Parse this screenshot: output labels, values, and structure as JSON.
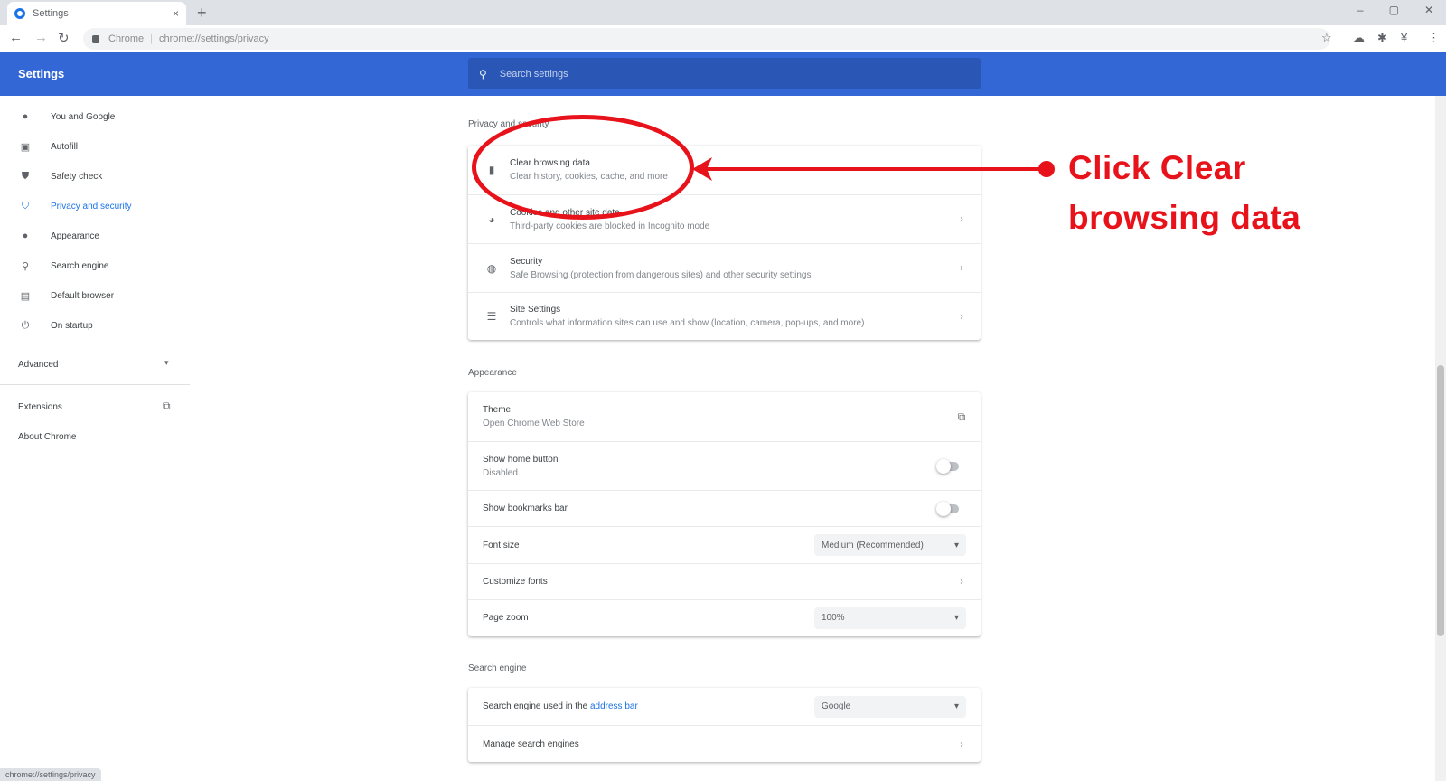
{
  "browser": {
    "tab_title": "Settings",
    "tab_close": "×",
    "new_tab": "+",
    "omnibox_site": "Chrome",
    "omnibox_separator": "|",
    "omnibox_url": "chrome://settings/privacy",
    "status_url": "chrome://settings/privacy",
    "window_controls": [
      "–",
      "▢",
      "✕"
    ],
    "toolbar_icons": [
      "star-icon",
      "cloud-icon",
      "extensions-icon",
      "extension-icon",
      "menu-icon"
    ]
  },
  "header": {
    "title": "Settings",
    "search_placeholder": "Search settings"
  },
  "sidebar": {
    "items": [
      {
        "label": "You and Google",
        "icon": "person-icon"
      },
      {
        "label": "Autofill",
        "icon": "clipboard-icon"
      },
      {
        "label": "Safety check",
        "icon": "shield-check-icon"
      },
      {
        "label": "Privacy and security",
        "icon": "shield-icon",
        "active": true
      },
      {
        "label": "Appearance",
        "icon": "palette-icon"
      },
      {
        "label": "Search engine",
        "icon": "search-icon"
      },
      {
        "label": "Default browser",
        "icon": "browser-icon"
      },
      {
        "label": "On startup",
        "icon": "power-icon"
      }
    ],
    "advanced": "Advanced",
    "extensions": "Extensions",
    "about": "About Chrome"
  },
  "privacy": {
    "section_title": "Privacy and security",
    "rows": [
      {
        "title": "Clear browsing data",
        "subtitle": "Clear history, cookies, cache, and more",
        "icon": "trash-icon"
      },
      {
        "title": "Cookies and other site data",
        "subtitle": "Third-party cookies are blocked in Incognito mode",
        "icon": "cookie-icon"
      },
      {
        "title": "Security",
        "subtitle": "Safe Browsing (protection from dangerous sites) and other security settings",
        "icon": "globe-shield-icon"
      },
      {
        "title": "Site Settings",
        "subtitle": "Controls what information sites can use and show (location, camera, pop-ups, and more)",
        "icon": "sliders-icon"
      }
    ]
  },
  "appearance": {
    "section_title": "Appearance",
    "theme_title": "Theme",
    "theme_subtitle": "Open Chrome Web Store",
    "home_title": "Show home button",
    "home_subtitle": "Disabled",
    "bookmarks_title": "Show bookmarks bar",
    "font_size_label": "Font size",
    "font_size_value": "Medium (Recommended)",
    "customize_fonts": "Customize fonts",
    "page_zoom_label": "Page zoom",
    "page_zoom_value": "100%"
  },
  "search_engine": {
    "section_title": "Search engine",
    "label_prefix": "Search engine used in the ",
    "label_link": "address bar",
    "value": "Google",
    "manage": "Manage search engines"
  },
  "annotation": {
    "line1": "Click Clear",
    "line2": "browsing data",
    "color": "#e8121b"
  }
}
